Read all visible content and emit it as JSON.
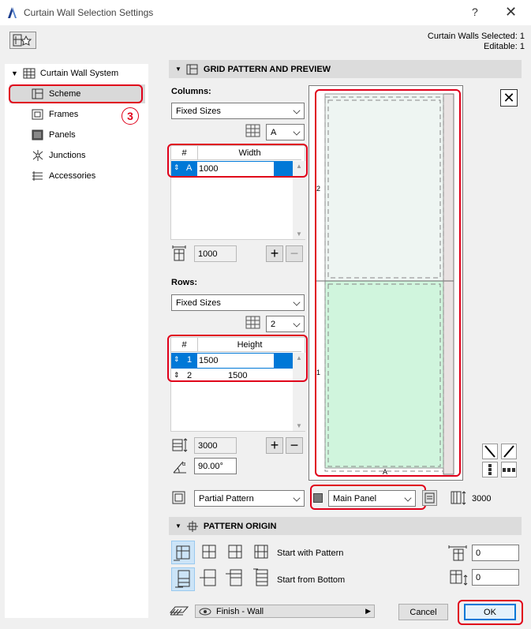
{
  "window": {
    "title": "Curtain Wall Selection Settings",
    "help": "?",
    "close": "✕"
  },
  "selection": {
    "selected": "Curtain Walls Selected: 1",
    "editable": "Editable: 1"
  },
  "tree": {
    "root": "Curtain Wall System",
    "items": [
      "Scheme",
      "Frames",
      "Panels",
      "Junctions",
      "Accessories"
    ],
    "annotation": "3"
  },
  "grid": {
    "header": "GRID PATTERN AND PREVIEW",
    "columns": {
      "label": "Columns:",
      "mode": "Fixed Sizes",
      "selector": "A",
      "headers": [
        "#",
        "Width"
      ],
      "rows": [
        {
          "id": "A",
          "value": "1000"
        }
      ],
      "total": "1000"
    },
    "rows": {
      "label": "Rows:",
      "mode": "Fixed Sizes",
      "selector": "2",
      "headers": [
        "#",
        "Height"
      ],
      "rows": [
        {
          "id": "1",
          "value": "1500"
        },
        {
          "id": "2",
          "value": "1500"
        }
      ],
      "total": "3000",
      "angle": "90.00°"
    },
    "preview": {
      "col_label": "A",
      "row_labels": [
        "2",
        "1"
      ]
    },
    "pattern_mode": "Partial Pattern",
    "panel_type": "Main Panel",
    "height_value": "3000"
  },
  "origin": {
    "header": "PATTERN ORIGIN",
    "start_with_pattern": "Start with Pattern",
    "start_from_bottom": "Start from Bottom",
    "offset_x": "0",
    "offset_y": "0"
  },
  "footer": {
    "layer": "Finish - Wall",
    "cancel": "Cancel",
    "ok": "OK"
  },
  "colors": {
    "accent": "#0078d7",
    "annotation": "#e0001a",
    "panel_fill": "#d0f5dd"
  }
}
